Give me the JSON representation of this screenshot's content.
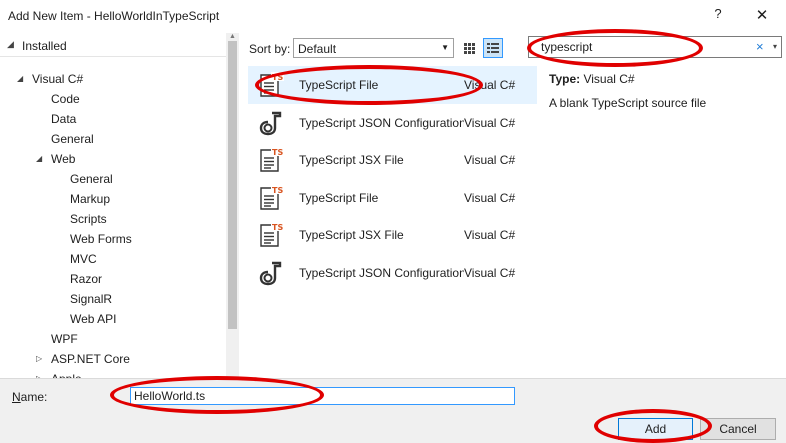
{
  "window": {
    "title": "Add New Item - HelloWorldInTypeScript",
    "help": "?",
    "close": "✕"
  },
  "tree": {
    "installed": "Installed",
    "items": [
      {
        "label": "Visual C#",
        "indent": 0
      },
      {
        "label": "Code",
        "indent": 1
      },
      {
        "label": "Data",
        "indent": 1
      },
      {
        "label": "General",
        "indent": 1
      },
      {
        "label": "Web",
        "indent": 1
      },
      {
        "label": "General",
        "indent": 2
      },
      {
        "label": "Markup",
        "indent": 2
      },
      {
        "label": "Scripts",
        "indent": 2
      },
      {
        "label": "Web Forms",
        "indent": 2
      },
      {
        "label": "MVC",
        "indent": 2
      },
      {
        "label": "Razor",
        "indent": 2
      },
      {
        "label": "SignalR",
        "indent": 2
      },
      {
        "label": "Web API",
        "indent": 2
      },
      {
        "label": "WPF",
        "indent": 1
      },
      {
        "label": "ASP.NET Core",
        "indent": 1
      },
      {
        "label": "Apple",
        "indent": 1
      }
    ]
  },
  "sort": {
    "label": "Sort by:",
    "value": "Default"
  },
  "search": {
    "value": "typescript",
    "clear": "×",
    "dropdown": "▾"
  },
  "templates": [
    {
      "name": "TypeScript File",
      "language": "Visual C#",
      "icon": "typescript-file-icon",
      "selected": true
    },
    {
      "name": "TypeScript JSON Configuration File",
      "language": "Visual C#",
      "icon": "json-config-icon",
      "selected": false
    },
    {
      "name": "TypeScript JSX File",
      "language": "Visual C#",
      "icon": "typescript-file-icon",
      "selected": false
    },
    {
      "name": "TypeScript File",
      "language": "Visual C#",
      "icon": "typescript-file-icon",
      "selected": false
    },
    {
      "name": "TypeScript JSX File",
      "language": "Visual C#",
      "icon": "typescript-file-icon",
      "selected": false
    },
    {
      "name": "TypeScript JSON Configuration File",
      "language": "Visual C#",
      "icon": "json-config-icon",
      "selected": false
    }
  ],
  "details": {
    "type_label": "Type:",
    "type_value": "Visual C#",
    "description": "A blank TypeScript source file"
  },
  "name_field": {
    "label_prefix": "N",
    "label_rest": "ame:",
    "value": "HelloWorld.ts"
  },
  "buttons": {
    "add": "Add",
    "cancel": "Cancel"
  },
  "colors": {
    "selection": "#e5f3ff",
    "annotation": "#e00000",
    "accent": "#0078d7"
  }
}
